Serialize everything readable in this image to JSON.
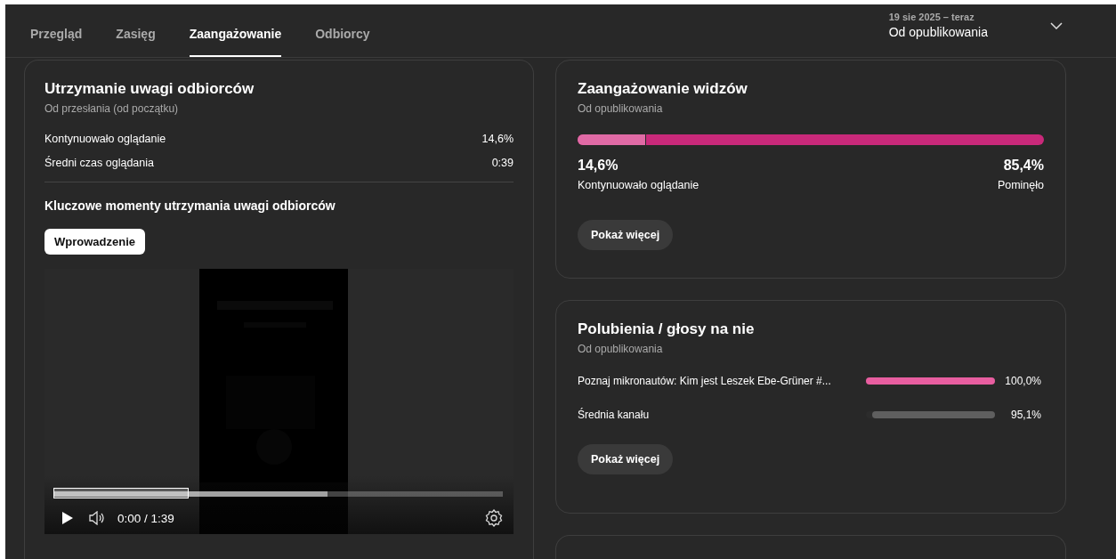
{
  "tabs": [
    {
      "label": "Przegląd",
      "selected": false
    },
    {
      "label": "Zasięg",
      "selected": false
    },
    {
      "label": "Zaangażowanie",
      "selected": true
    },
    {
      "label": "Odbiorcy",
      "selected": false
    }
  ],
  "date_range": {
    "range": "19 sie 2025 – teraz",
    "label": "Od opublikowania"
  },
  "retention": {
    "title": "Utrzymanie uwagi odbiorców",
    "subtitle": "Od przesłania (od początku)",
    "stats": [
      {
        "label": "Kontynuowało oglądanie",
        "value": "14,6%"
      },
      {
        "label": "Średni czas oglądania",
        "value": "0:39"
      }
    ],
    "key_moments_title": "Kluczowe momenty utrzymania uwagi odbiorców",
    "moment_tabs": [
      {
        "label": "Wprowadzenie",
        "selected": true
      }
    ],
    "player": {
      "time": "0:00 / 1:39",
      "buffer": {
        "level": 0.61
      },
      "segment": {
        "level": 0.3
      }
    }
  },
  "viewer_engagement": {
    "title": "Zaangażowanie widzów",
    "subtitle": "Od opublikowania",
    "split": [
      {
        "value": "14,6%",
        "label": "Kontynuowało oglądanie",
        "level": 0.146,
        "color": "#e06aa5"
      },
      {
        "value": "85,4%",
        "label": "Pominęło",
        "color": "#c9297a"
      }
    ],
    "button": "Pokaż więcej"
  },
  "likes": {
    "title": "Polubienia / głosy na nie",
    "subtitle": "Od opublikowania",
    "rows": [
      {
        "label": "Poznaj mikronautów: Kim jest Leszek Ebe-Grüner #...",
        "level": 1.0,
        "value": "100,0%",
        "color": "#e85ea0"
      },
      {
        "label": "Średnia kanału",
        "level": 0.951,
        "value": "95,1%",
        "color": "#5f5f5f"
      }
    ],
    "button": "Pokaż więcej"
  }
}
